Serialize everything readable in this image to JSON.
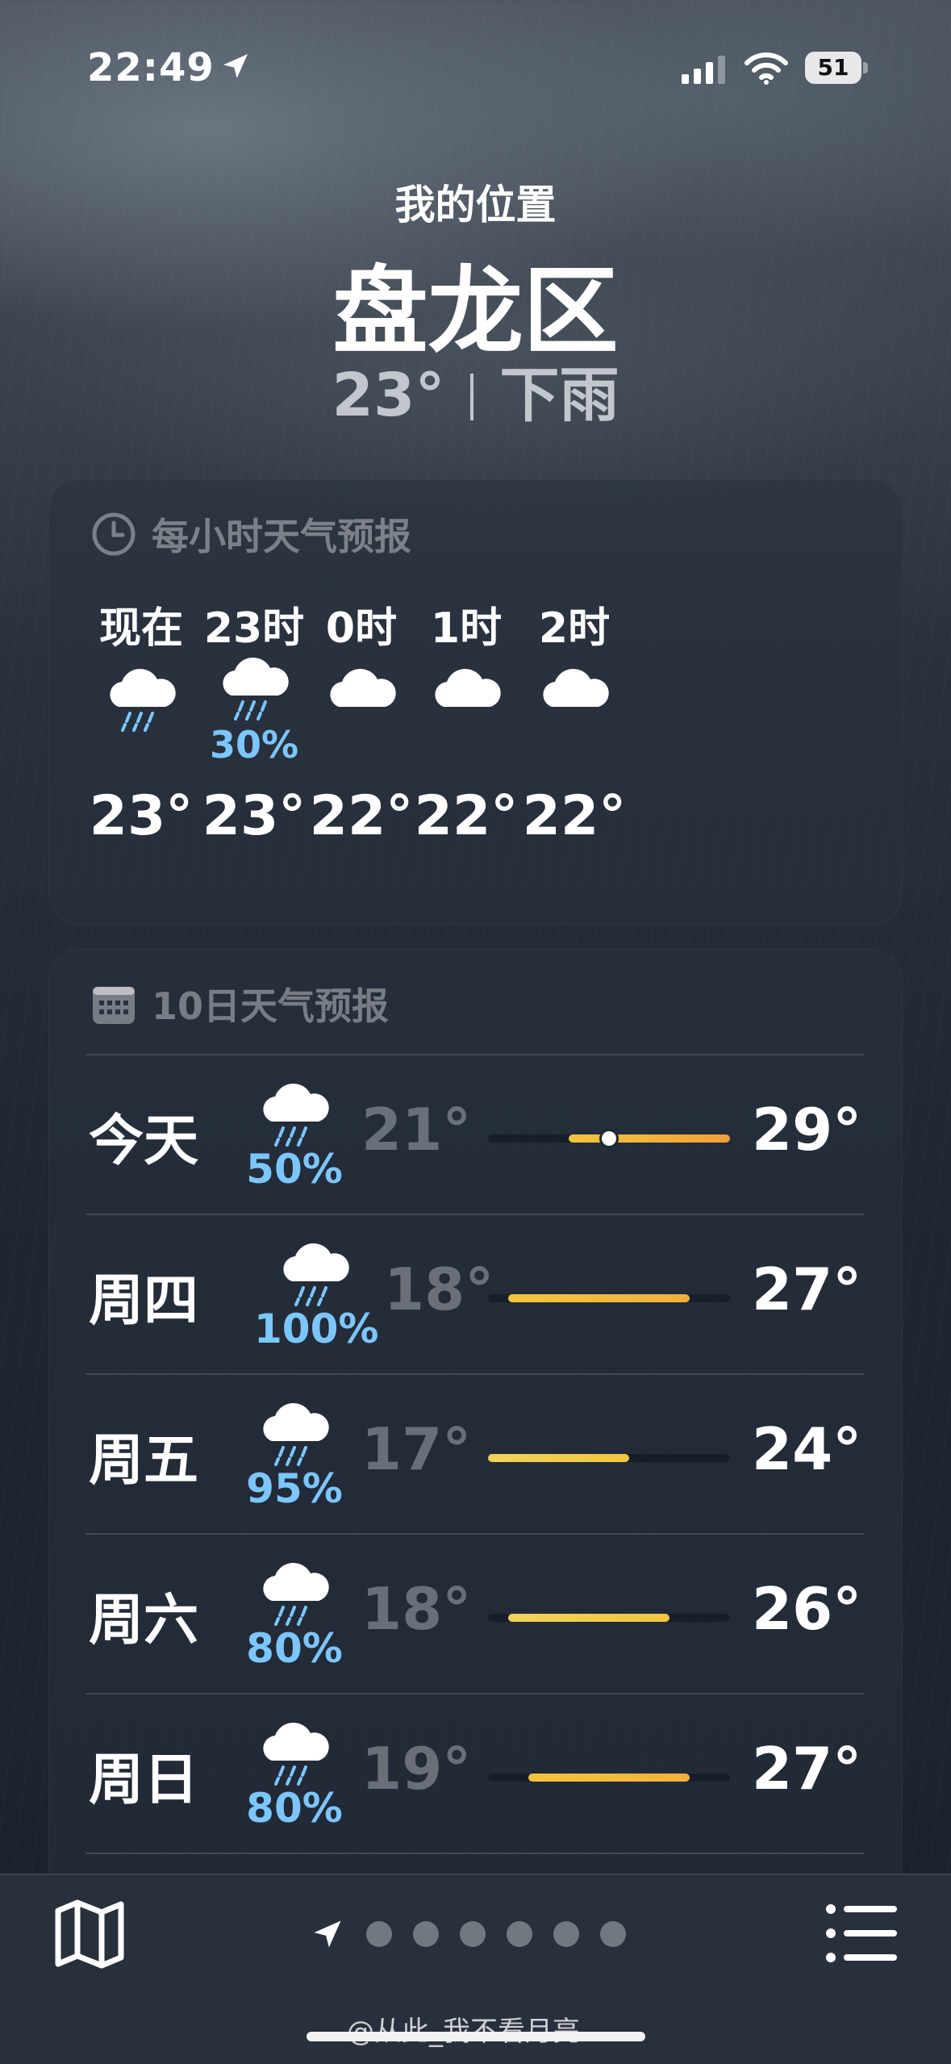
{
  "status_bar": {
    "time": "22:49",
    "battery": "51"
  },
  "header": {
    "location_label": "我的位置",
    "city": "盘龙区",
    "current_temp": "23°",
    "condition": "下雨"
  },
  "hourly": {
    "title": "每小时天气预报",
    "items": [
      {
        "label": "现在",
        "icon": "rain-cloud-icon",
        "pct": "",
        "temp": "23°"
      },
      {
        "label": "23时",
        "icon": "rain-cloud-icon",
        "pct": "30%",
        "temp": "23°"
      },
      {
        "label": "0时",
        "icon": "cloud-icon",
        "pct": "",
        "temp": "22°"
      },
      {
        "label": "1时",
        "icon": "cloud-icon",
        "pct": "",
        "temp": "22°"
      },
      {
        "label": "2时",
        "icon": "cloud-icon",
        "pct": "",
        "temp": "22°"
      }
    ]
  },
  "daily": {
    "title": "10日天气预报",
    "range_min": 17,
    "range_max": 29,
    "items": [
      {
        "day": "今天",
        "icon": "rain-cloud-icon",
        "pct": "50%",
        "low": "21°",
        "high": "29°",
        "low_val": 21,
        "high_val": 29,
        "current_val": 23,
        "colors": [
          "#f2c53d",
          "#f0a03a"
        ]
      },
      {
        "day": "周四",
        "icon": "rain-cloud-icon",
        "pct": "100%",
        "low": "18°",
        "high": "27°",
        "low_val": 18,
        "high_val": 27,
        "colors": [
          "#f2c53d",
          "#f0b23a"
        ]
      },
      {
        "day": "周五",
        "icon": "rain-cloud-icon",
        "pct": "95%",
        "low": "17°",
        "high": "24°",
        "low_val": 17,
        "high_val": 24,
        "colors": [
          "#f2d35a",
          "#f2c53d"
        ]
      },
      {
        "day": "周六",
        "icon": "rain-cloud-icon",
        "pct": "80%",
        "low": "18°",
        "high": "26°",
        "low_val": 18,
        "high_val": 26,
        "colors": [
          "#f2d35a",
          "#f2c53d"
        ]
      },
      {
        "day": "周日",
        "icon": "rain-cloud-icon",
        "pct": "80%",
        "low": "19°",
        "high": "27°",
        "low_val": 19,
        "high_val": 27,
        "colors": [
          "#f2c53d",
          "#f0b23a"
        ]
      }
    ]
  },
  "pager": {
    "total_dots": 6
  },
  "watermark": "@从此_我不看月亮"
}
